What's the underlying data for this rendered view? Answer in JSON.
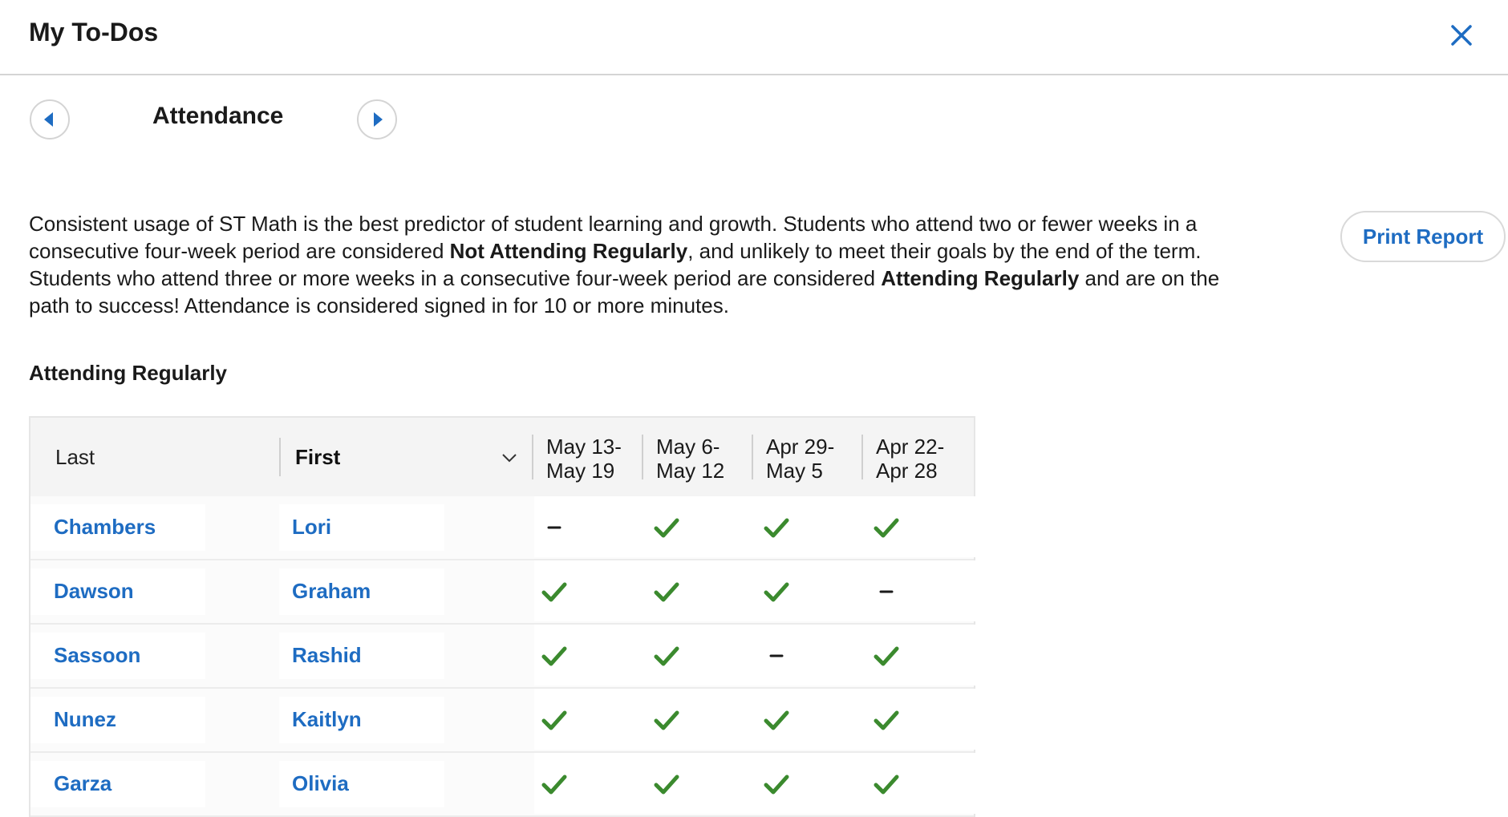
{
  "header": {
    "title": "My To-Dos",
    "close_icon": "close-icon"
  },
  "nav": {
    "section_title": "Attendance",
    "prev_icon": "chevron-left-icon",
    "next_icon": "chevron-right-icon"
  },
  "description": {
    "part1": "Consistent usage of ST Math is the best predictor of student learning and growth. Students who attend two or fewer weeks in a consecutive four-week period are considered ",
    "bold1": "Not Attending Regularly",
    "part2": ", and unlikely to meet their goals by the end of the term. Students who attend three or more weeks in a consecutive four-week period are considered ",
    "bold2": "Attending Regularly",
    "part3": " and are on the path to success! Attendance is considered signed in for 10 or more minutes."
  },
  "print_button": "Print Report",
  "table_title": "Attending Regularly",
  "table": {
    "columns": {
      "last": "Last",
      "first": "First",
      "sort_icon": "chevron-down-icon",
      "weeks": [
        {
          "line1": "May 13-",
          "line2": "May 19"
        },
        {
          "line1": "May 6-",
          "line2": "May 12"
        },
        {
          "line1": "Apr 29-",
          "line2": "May 5"
        },
        {
          "line1": "Apr 22-",
          "line2": "Apr 28"
        }
      ]
    },
    "rows": [
      {
        "last": "Chambers",
        "first": "Lori",
        "weeks": [
          "dash",
          "check",
          "check",
          "check"
        ]
      },
      {
        "last": "Dawson",
        "first": "Graham",
        "weeks": [
          "check",
          "check",
          "check",
          "dash"
        ]
      },
      {
        "last": "Sassoon",
        "first": "Rashid",
        "weeks": [
          "check",
          "check",
          "dash",
          "check"
        ]
      },
      {
        "last": "Nunez",
        "first": "Kaitlyn",
        "weeks": [
          "check",
          "check",
          "check",
          "check"
        ]
      },
      {
        "last": "Garza",
        "first": "Olivia",
        "weeks": [
          "check",
          "check",
          "check",
          "check"
        ]
      }
    ]
  },
  "colors": {
    "link": "#1e6cc2",
    "check": "#3b8a2e",
    "dash": "#1a1a1a"
  }
}
